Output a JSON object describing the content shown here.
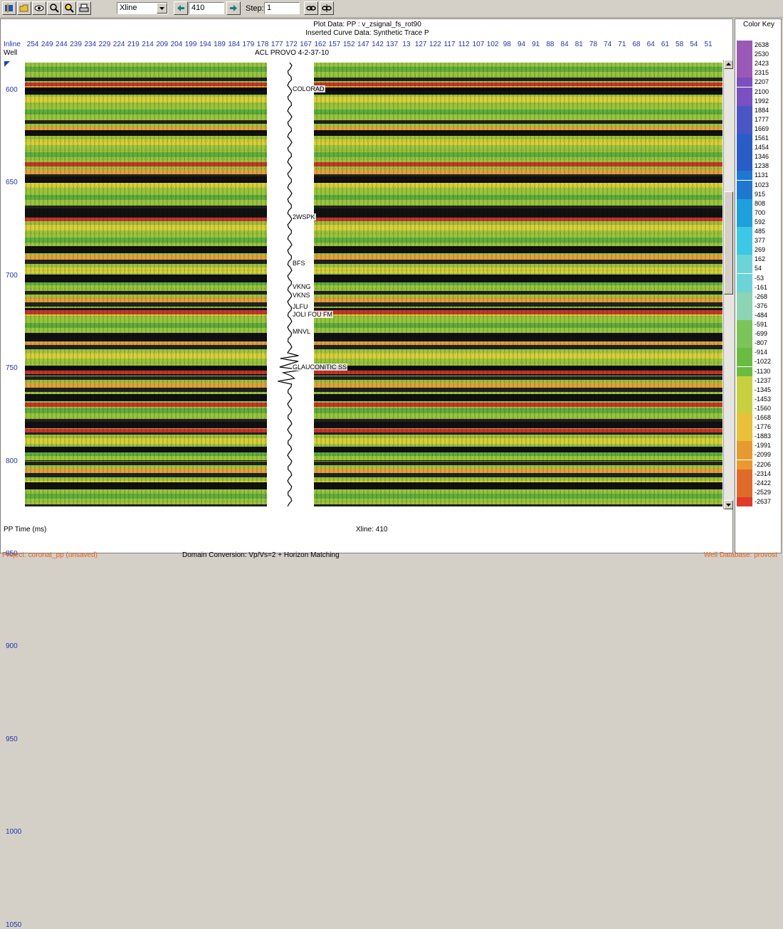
{
  "toolbar": {
    "buttons": [
      "open-well-icon",
      "open-folder-icon",
      "eye-icon",
      "zoom-icon",
      "zoom-area-icon",
      "print-icon"
    ],
    "axis_select": "Xline",
    "line_value": "410",
    "step_label": "Step:",
    "step_value": "1"
  },
  "header": {
    "plot_data": "Plot Data: PP : v_zsignal_fs_rot90",
    "inserted_curve": "Inserted Curve Data:  Synthetic Trace P"
  },
  "axes": {
    "inline_label": "Inline",
    "well_label": "Well",
    "well_name": "ACL PROVO 4-2-37-10",
    "x_ticks": [
      "254",
      "249",
      "244",
      "239",
      "234",
      "229",
      "224",
      "219",
      "214",
      "209",
      "204",
      "199",
      "194",
      "189",
      "184",
      "179",
      "178",
      "177",
      "172",
      "167",
      "162",
      "157",
      "152",
      "147",
      "142",
      "137",
      "13",
      "127",
      "122",
      "117",
      "112",
      "107",
      "102",
      "98",
      "94",
      "91",
      "88",
      "84",
      "81",
      "78",
      "74",
      "71",
      "68",
      "64",
      "61",
      "58",
      "54",
      "51"
    ],
    "y_ticks": [
      "600",
      "650",
      "700",
      "750",
      "800",
      "850",
      "900",
      "950",
      "1000",
      "1050"
    ],
    "y_unit": "PP Time (ms)",
    "xline_status": "Xline: 410"
  },
  "horizons": [
    "COLORAD",
    "2WSPK",
    "BFS",
    "VKNG",
    "VKNS",
    "JLFU",
    "JOLI FOU FM",
    "MNVL",
    "GLAUCONITIC SS"
  ],
  "color_key": {
    "title": "Color Key",
    "values": [
      "2638",
      "2530",
      "2423",
      "2315",
      "2207",
      "2100",
      "1992",
      "1884",
      "1777",
      "1669",
      "1561",
      "1454",
      "1346",
      "1238",
      "1131",
      "1023",
      "915",
      "808",
      "700",
      "592",
      "485",
      "377",
      "269",
      "162",
      "54",
      "-53",
      "-161",
      "-268",
      "-376",
      "-484",
      "-591",
      "-699",
      "-807",
      "-914",
      "-1022",
      "-1130",
      "-1237",
      "-1345",
      "-1453",
      "-1560",
      "-1668",
      "-1776",
      "-1883",
      "-1991",
      "-2099",
      "-2206",
      "-2314",
      "-2422",
      "-2529",
      "-2637"
    ],
    "top_color": "#9b59b6",
    "bottom_color": "#e03a2a"
  },
  "status": {
    "project": "Project: coronat_pp (unsaved)",
    "domain": "Domain Conversion: Vp/Vs=2 + Horizon Matching",
    "database": "Well Database: provost",
    "accent": "#e06020"
  }
}
